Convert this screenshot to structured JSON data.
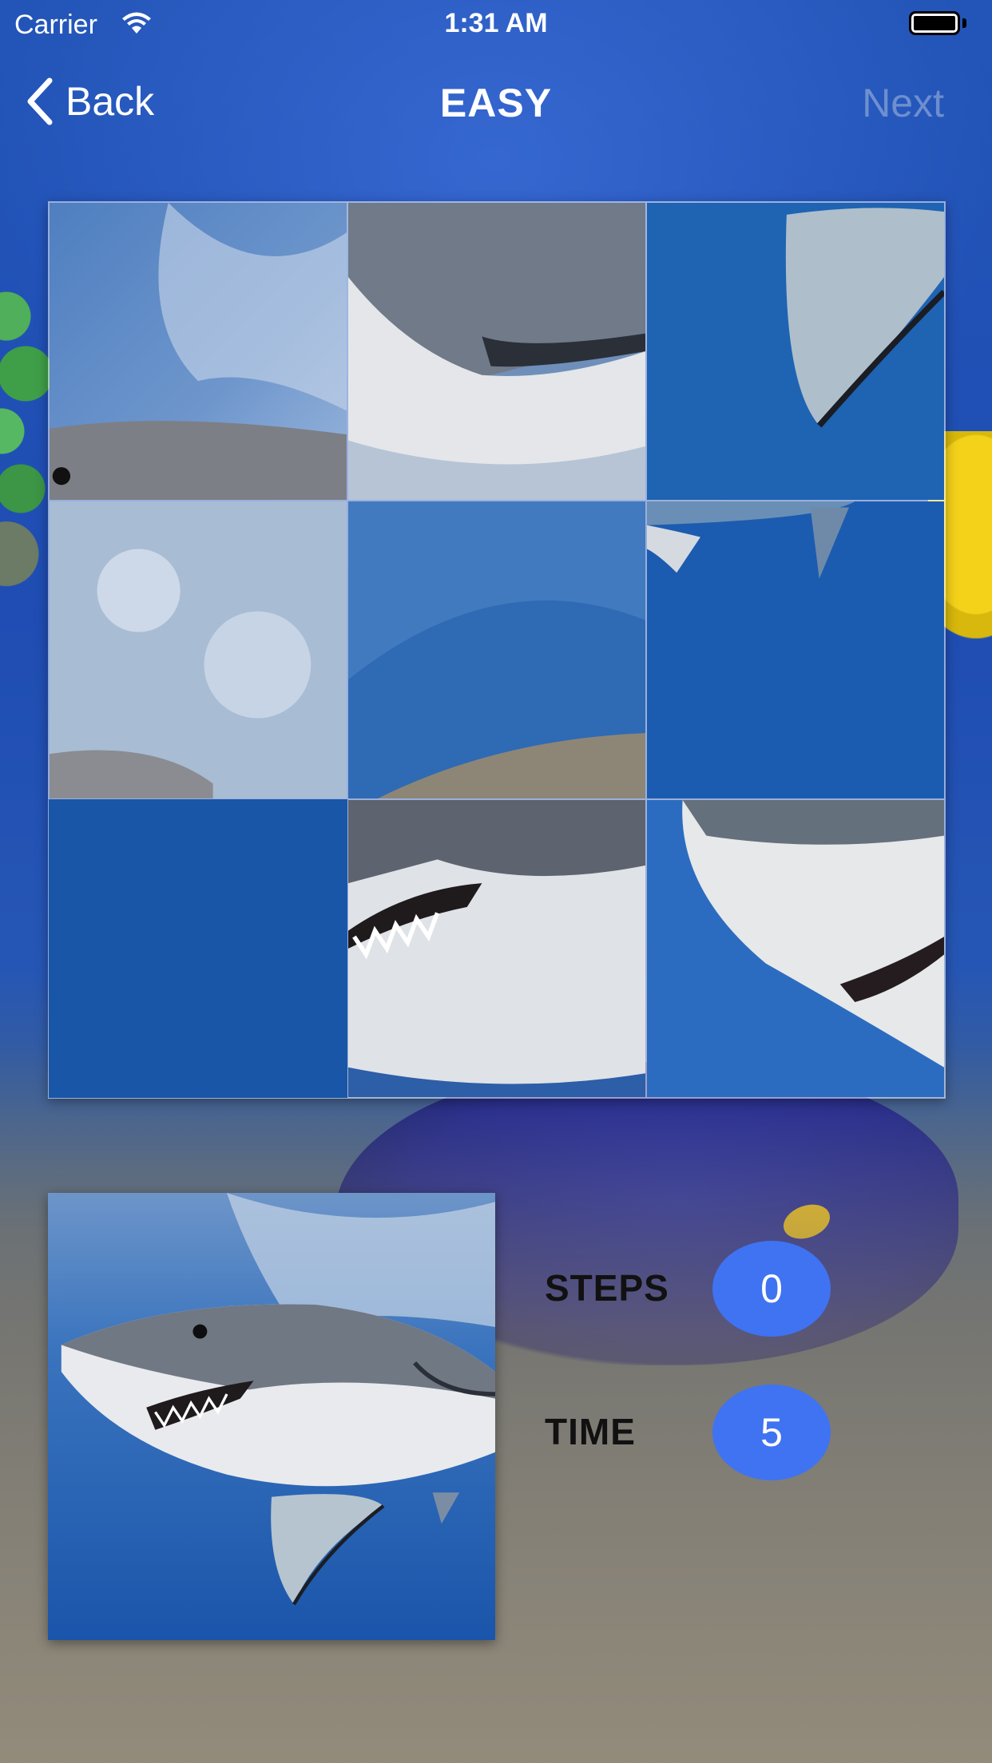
{
  "status_bar": {
    "carrier": "Carrier",
    "time": "1:31 AM"
  },
  "nav": {
    "back_label": "Back",
    "title": "EASY",
    "next_label": "Next"
  },
  "board": {
    "grid": "3x3",
    "empty_tile_index": 6
  },
  "stats": {
    "steps_label": "STEPS",
    "steps_value": "0",
    "time_label": "TIME",
    "time_value": "5"
  },
  "colors": {
    "badge": "#3f73f2",
    "water": "#1f4db3",
    "nav_text": "#ffffff",
    "next_disabled": "#c8d2e6"
  },
  "icons": [
    "wifi-icon",
    "battery-icon",
    "back-chevron-icon"
  ]
}
